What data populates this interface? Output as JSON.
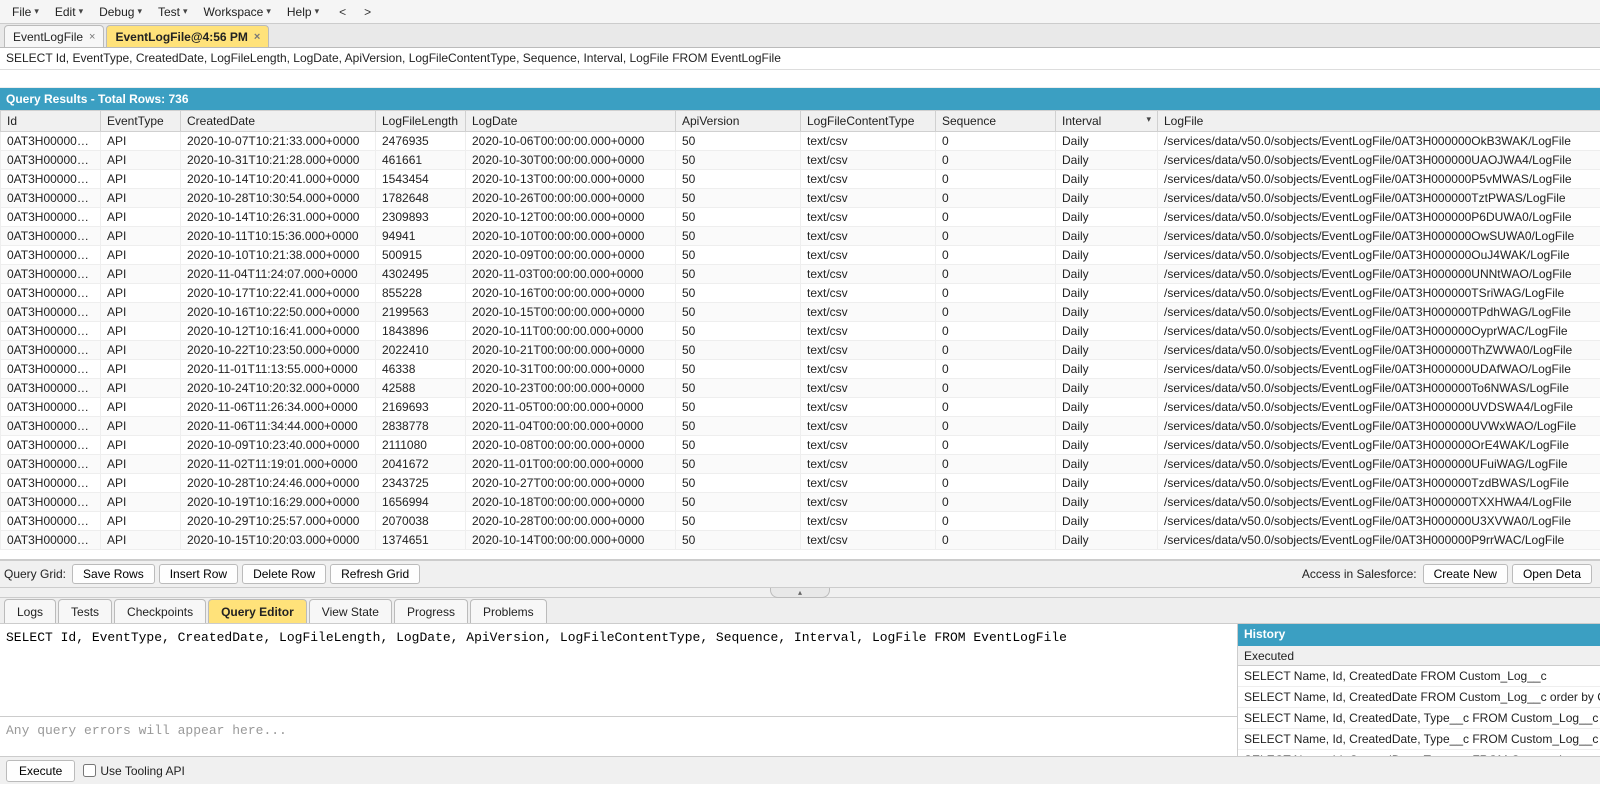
{
  "menu": {
    "items": [
      "File",
      "Edit",
      "Debug",
      "Test",
      "Workspace",
      "Help"
    ]
  },
  "tabs": [
    {
      "label": "EventLogFile",
      "active": false
    },
    {
      "label": "EventLogFile@4:56 PM",
      "active": true
    }
  ],
  "query_statement": "SELECT Id, EventType, CreatedDate, LogFileLength, LogDate, ApiVersion, LogFileContentType, Sequence, Interval, LogFile FROM EventLogFile",
  "results_header": "Query Results - Total Rows: 736",
  "columns": [
    "Id",
    "EventType",
    "CreatedDate",
    "LogFileLength",
    "LogDate",
    "ApiVersion",
    "LogFileContentType",
    "Sequence",
    "Interval",
    "LogFile"
  ],
  "sorted_column_index": 8,
  "rows": [
    {
      "Id": "0AT3H000000Ok...",
      "EventType": "API",
      "CreatedDate": "2020-10-07T10:21:33.000+0000",
      "LogFileLength": "2476935",
      "LogDate": "2020-10-06T00:00:00.000+0000",
      "ApiVersion": "50",
      "LogFileContentType": "text/csv",
      "Sequence": "0",
      "Interval": "Daily",
      "LogFile": "/services/data/v50.0/sobjects/EventLogFile/0AT3H000000OkB3WAK/LogFile"
    },
    {
      "Id": "0AT3H000000UA...",
      "EventType": "API",
      "CreatedDate": "2020-10-31T10:21:28.000+0000",
      "LogFileLength": "461661",
      "LogDate": "2020-10-30T00:00:00.000+0000",
      "ApiVersion": "50",
      "LogFileContentType": "text/csv",
      "Sequence": "0",
      "Interval": "Daily",
      "LogFile": "/services/data/v50.0/sobjects/EventLogFile/0AT3H000000UAOJWA4/LogFile"
    },
    {
      "Id": "0AT3H000000P5...",
      "EventType": "API",
      "CreatedDate": "2020-10-14T10:20:41.000+0000",
      "LogFileLength": "1543454",
      "LogDate": "2020-10-13T00:00:00.000+0000",
      "ApiVersion": "50",
      "LogFileContentType": "text/csv",
      "Sequence": "0",
      "Interval": "Daily",
      "LogFile": "/services/data/v50.0/sobjects/EventLogFile/0AT3H000000P5vMWAS/LogFile"
    },
    {
      "Id": "0AT3H000000Tzt...",
      "EventType": "API",
      "CreatedDate": "2020-10-28T10:30:54.000+0000",
      "LogFileLength": "1782648",
      "LogDate": "2020-10-26T00:00:00.000+0000",
      "ApiVersion": "50",
      "LogFileContentType": "text/csv",
      "Sequence": "0",
      "Interval": "Daily",
      "LogFile": "/services/data/v50.0/sobjects/EventLogFile/0AT3H000000TztPWAS/LogFile"
    },
    {
      "Id": "0AT3H000000P6...",
      "EventType": "API",
      "CreatedDate": "2020-10-14T10:26:31.000+0000",
      "LogFileLength": "2309893",
      "LogDate": "2020-10-12T00:00:00.000+0000",
      "ApiVersion": "50",
      "LogFileContentType": "text/csv",
      "Sequence": "0",
      "Interval": "Daily",
      "LogFile": "/services/data/v50.0/sobjects/EventLogFile/0AT3H000000P6DUWA0/LogFile"
    },
    {
      "Id": "0AT3H000000Ow...",
      "EventType": "API",
      "CreatedDate": "2020-10-11T10:15:36.000+0000",
      "LogFileLength": "94941",
      "LogDate": "2020-10-10T00:00:00.000+0000",
      "ApiVersion": "50",
      "LogFileContentType": "text/csv",
      "Sequence": "0",
      "Interval": "Daily",
      "LogFile": "/services/data/v50.0/sobjects/EventLogFile/0AT3H000000OwSUWA0/LogFile"
    },
    {
      "Id": "0AT3H000000Ou...",
      "EventType": "API",
      "CreatedDate": "2020-10-10T10:21:38.000+0000",
      "LogFileLength": "500915",
      "LogDate": "2020-10-09T00:00:00.000+0000",
      "ApiVersion": "50",
      "LogFileContentType": "text/csv",
      "Sequence": "0",
      "Interval": "Daily",
      "LogFile": "/services/data/v50.0/sobjects/EventLogFile/0AT3H000000OuJ4WAK/LogFile"
    },
    {
      "Id": "0AT3H000000UN...",
      "EventType": "API",
      "CreatedDate": "2020-11-04T11:24:07.000+0000",
      "LogFileLength": "4302495",
      "LogDate": "2020-11-03T00:00:00.000+0000",
      "ApiVersion": "50",
      "LogFileContentType": "text/csv",
      "Sequence": "0",
      "Interval": "Daily",
      "LogFile": "/services/data/v50.0/sobjects/EventLogFile/0AT3H000000UNNtWAO/LogFile"
    },
    {
      "Id": "0AT3H000000TSr...",
      "EventType": "API",
      "CreatedDate": "2020-10-17T10:22:41.000+0000",
      "LogFileLength": "855228",
      "LogDate": "2020-10-16T00:00:00.000+0000",
      "ApiVersion": "50",
      "LogFileContentType": "text/csv",
      "Sequence": "0",
      "Interval": "Daily",
      "LogFile": "/services/data/v50.0/sobjects/EventLogFile/0AT3H000000TSriWAG/LogFile"
    },
    {
      "Id": "0AT3H000000TP...",
      "EventType": "API",
      "CreatedDate": "2020-10-16T10:22:50.000+0000",
      "LogFileLength": "2199563",
      "LogDate": "2020-10-15T00:00:00.000+0000",
      "ApiVersion": "50",
      "LogFileContentType": "text/csv",
      "Sequence": "0",
      "Interval": "Daily",
      "LogFile": "/services/data/v50.0/sobjects/EventLogFile/0AT3H000000TPdhWAG/LogFile"
    },
    {
      "Id": "0AT3H000000Oy...",
      "EventType": "API",
      "CreatedDate": "2020-10-12T10:16:41.000+0000",
      "LogFileLength": "1843896",
      "LogDate": "2020-10-11T00:00:00.000+0000",
      "ApiVersion": "50",
      "LogFileContentType": "text/csv",
      "Sequence": "0",
      "Interval": "Daily",
      "LogFile": "/services/data/v50.0/sobjects/EventLogFile/0AT3H000000OyprWAC/LogFile"
    },
    {
      "Id": "0AT3H000000Th...",
      "EventType": "API",
      "CreatedDate": "2020-10-22T10:23:50.000+0000",
      "LogFileLength": "2022410",
      "LogDate": "2020-10-21T00:00:00.000+0000",
      "ApiVersion": "50",
      "LogFileContentType": "text/csv",
      "Sequence": "0",
      "Interval": "Daily",
      "LogFile": "/services/data/v50.0/sobjects/EventLogFile/0AT3H000000ThZWWA0/LogFile"
    },
    {
      "Id": "0AT3H000000UD...",
      "EventType": "API",
      "CreatedDate": "2020-11-01T11:13:55.000+0000",
      "LogFileLength": "46338",
      "LogDate": "2020-10-31T00:00:00.000+0000",
      "ApiVersion": "50",
      "LogFileContentType": "text/csv",
      "Sequence": "0",
      "Interval": "Daily",
      "LogFile": "/services/data/v50.0/sobjects/EventLogFile/0AT3H000000UDAfWAO/LogFile"
    },
    {
      "Id": "0AT3H000000To6...",
      "EventType": "API",
      "CreatedDate": "2020-10-24T10:20:32.000+0000",
      "LogFileLength": "42588",
      "LogDate": "2020-10-23T00:00:00.000+0000",
      "ApiVersion": "50",
      "LogFileContentType": "text/csv",
      "Sequence": "0",
      "Interval": "Daily",
      "LogFile": "/services/data/v50.0/sobjects/EventLogFile/0AT3H000000To6NWAS/LogFile"
    },
    {
      "Id": "0AT3H000000UV...",
      "EventType": "API",
      "CreatedDate": "2020-11-06T11:26:34.000+0000",
      "LogFileLength": "2169693",
      "LogDate": "2020-11-05T00:00:00.000+0000",
      "ApiVersion": "50",
      "LogFileContentType": "text/csv",
      "Sequence": "0",
      "Interval": "Daily",
      "LogFile": "/services/data/v50.0/sobjects/EventLogFile/0AT3H000000UVDSWA4/LogFile"
    },
    {
      "Id": "0AT3H000000UV...",
      "EventType": "API",
      "CreatedDate": "2020-11-06T11:34:44.000+0000",
      "LogFileLength": "2838778",
      "LogDate": "2020-11-04T00:00:00.000+0000",
      "ApiVersion": "50",
      "LogFileContentType": "text/csv",
      "Sequence": "0",
      "Interval": "Daily",
      "LogFile": "/services/data/v50.0/sobjects/EventLogFile/0AT3H000000UVWxWAO/LogFile"
    },
    {
      "Id": "0AT3H000000Or...",
      "EventType": "API",
      "CreatedDate": "2020-10-09T10:23:40.000+0000",
      "LogFileLength": "2111080",
      "LogDate": "2020-10-08T00:00:00.000+0000",
      "ApiVersion": "50",
      "LogFileContentType": "text/csv",
      "Sequence": "0",
      "Interval": "Daily",
      "LogFile": "/services/data/v50.0/sobjects/EventLogFile/0AT3H000000OrE4WAK/LogFile"
    },
    {
      "Id": "0AT3H000000UF...",
      "EventType": "API",
      "CreatedDate": "2020-11-02T11:19:01.000+0000",
      "LogFileLength": "2041672",
      "LogDate": "2020-11-01T00:00:00.000+0000",
      "ApiVersion": "50",
      "LogFileContentType": "text/csv",
      "Sequence": "0",
      "Interval": "Daily",
      "LogFile": "/services/data/v50.0/sobjects/EventLogFile/0AT3H000000UFuiWAG/LogFile"
    },
    {
      "Id": "0AT3H000000Tzd...",
      "EventType": "API",
      "CreatedDate": "2020-10-28T10:24:46.000+0000",
      "LogFileLength": "2343725",
      "LogDate": "2020-10-27T00:00:00.000+0000",
      "ApiVersion": "50",
      "LogFileContentType": "text/csv",
      "Sequence": "0",
      "Interval": "Daily",
      "LogFile": "/services/data/v50.0/sobjects/EventLogFile/0AT3H000000TzdBWAS/LogFile"
    },
    {
      "Id": "0AT3H000000TX...",
      "EventType": "API",
      "CreatedDate": "2020-10-19T10:16:29.000+0000",
      "LogFileLength": "1656994",
      "LogDate": "2020-10-18T00:00:00.000+0000",
      "ApiVersion": "50",
      "LogFileContentType": "text/csv",
      "Sequence": "0",
      "Interval": "Daily",
      "LogFile": "/services/data/v50.0/sobjects/EventLogFile/0AT3H000000TXXHWA4/LogFile"
    },
    {
      "Id": "0AT3H000000U3...",
      "EventType": "API",
      "CreatedDate": "2020-10-29T10:25:57.000+0000",
      "LogFileLength": "2070038",
      "LogDate": "2020-10-28T00:00:00.000+0000",
      "ApiVersion": "50",
      "LogFileContentType": "text/csv",
      "Sequence": "0",
      "Interval": "Daily",
      "LogFile": "/services/data/v50.0/sobjects/EventLogFile/0AT3H000000U3XVWA0/LogFile"
    },
    {
      "Id": "0AT3H000000P9r...",
      "EventType": "API",
      "CreatedDate": "2020-10-15T10:20:03.000+0000",
      "LogFileLength": "1374651",
      "LogDate": "2020-10-14T00:00:00.000+0000",
      "ApiVersion": "50",
      "LogFileContentType": "text/csv",
      "Sequence": "0",
      "Interval": "Daily",
      "LogFile": "/services/data/v50.0/sobjects/EventLogFile/0AT3H000000P9rrWAC/LogFile"
    }
  ],
  "grid_toolbar": {
    "label": "Query Grid:",
    "save_rows": "Save Rows",
    "insert_row": "Insert Row",
    "delete_row": "Delete Row",
    "refresh_grid": "Refresh Grid",
    "sf_label": "Access in Salesforce:",
    "create_new": "Create New",
    "open_detail": "Open Deta"
  },
  "bottom_tabs": [
    "Logs",
    "Tests",
    "Checkpoints",
    "Query Editor",
    "View State",
    "Progress",
    "Problems"
  ],
  "bottom_active_tab": 3,
  "editor": {
    "value": "SELECT Id, EventType, CreatedDate, LogFileLength, LogDate, ApiVersion, LogFileContentType, Sequence, Interval, LogFile FROM EventLogFile",
    "error_placeholder": "Any query errors will appear here..."
  },
  "history": {
    "title": "History",
    "sub": "Executed",
    "items": [
      "SELECT Name, Id, CreatedDate FROM Custom_Log__c",
      "SELECT Name, Id, CreatedDate FROM Custom_Log__c order by C",
      "SELECT Name, Id, CreatedDate, Type__c FROM Custom_Log__c o",
      "SELECT Name, Id, CreatedDate, Type__c FROM Custom_Log__c w",
      "SELECT Name, Id, CreatedDate, Type__c FROM Custom_Log__c w"
    ]
  },
  "exec": {
    "execute": "Execute",
    "use_tooling": "Use Tooling API"
  }
}
